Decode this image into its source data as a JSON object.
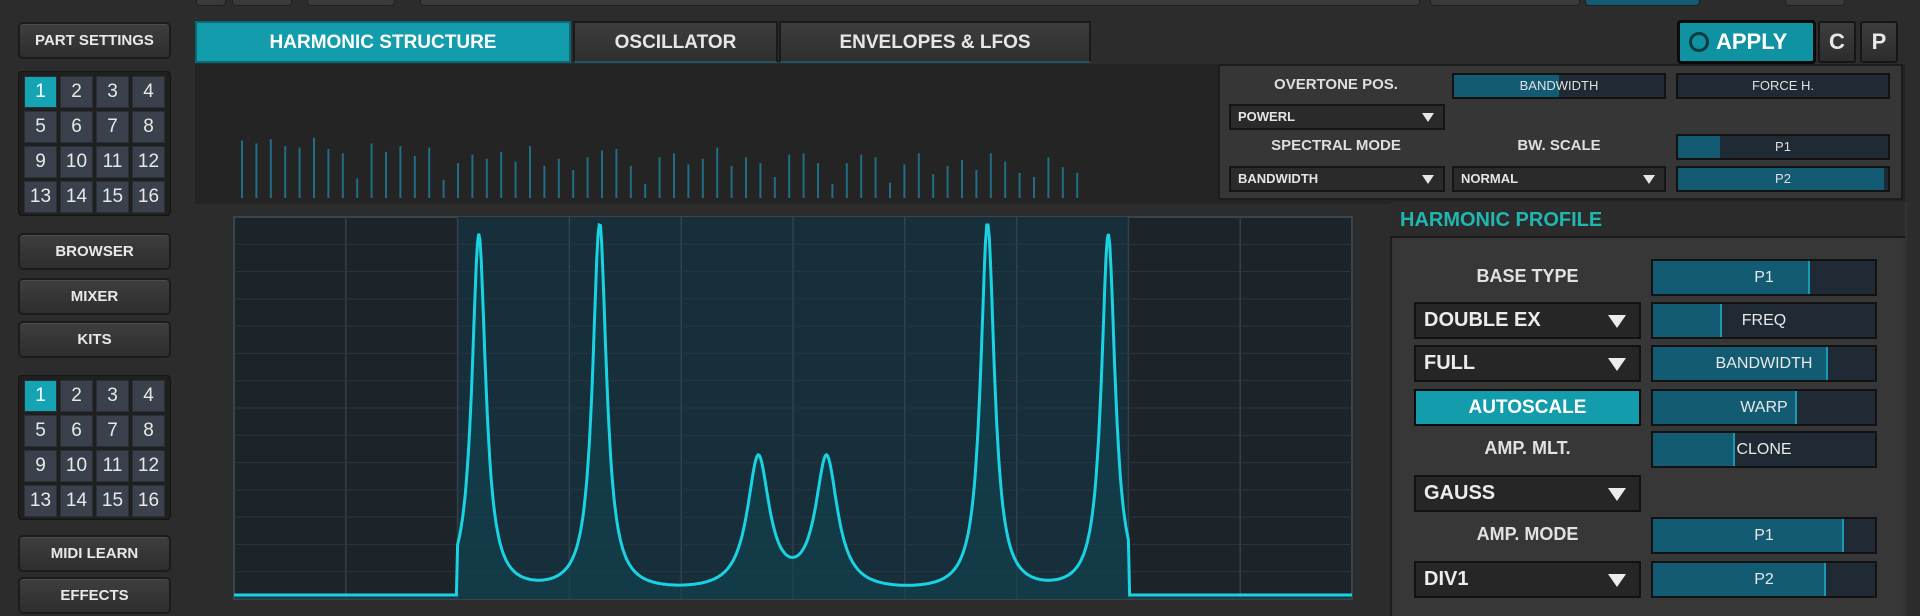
{
  "left_panel": {
    "part_settings_label": "PART SETTINGS",
    "part_grid": [
      "1",
      "2",
      "3",
      "4",
      "5",
      "6",
      "7",
      "8",
      "9",
      "10",
      "11",
      "12",
      "13",
      "14",
      "15",
      "16"
    ],
    "part_selected": "1",
    "browser_label": "BROWSER",
    "mixer_label": "MIXER",
    "kits_label": "KITS",
    "kit_grid": [
      "1",
      "2",
      "3",
      "4",
      "5",
      "6",
      "7",
      "8",
      "9",
      "10",
      "11",
      "12",
      "13",
      "14",
      "15",
      "16"
    ],
    "kit_selected": "1",
    "midi_learn_label": "MIDI LEARN",
    "effects_label": "EFFECTS"
  },
  "tabs": [
    {
      "label": "HARMONIC STRUCTURE",
      "active": true
    },
    {
      "label": "OSCILLATOR",
      "active": false
    },
    {
      "label": "ENVELOPES & LFOS",
      "active": false
    }
  ],
  "header_buttons": {
    "apply_label": "APPLY",
    "c_label": "C",
    "p_label": "P"
  },
  "overtone_panel": {
    "overtone_pos_label": "OVERTONE POS.",
    "overtone_pos_value": "POWERL",
    "bandwidth_slider": {
      "label": "BANDWIDTH",
      "level": 0.5
    },
    "force_h_slider": {
      "label": "FORCE H.",
      "level": 0.0
    },
    "spectral_mode_label": "SPECTRAL MODE",
    "spectral_mode_value": "BANDWIDTH",
    "bw_scale_label": "BW. SCALE",
    "bw_scale_value": "NORMAL",
    "p1_slider": {
      "label": "P1",
      "level": 0.2
    },
    "p2_slider": {
      "label": "P2",
      "level": 0.98
    }
  },
  "harmonic_bars": [
    0.82,
    0.78,
    0.84,
    0.74,
    0.72,
    0.86,
    0.7,
    0.64,
    0.28,
    0.78,
    0.66,
    0.74,
    0.6,
    0.72,
    0.26,
    0.5,
    0.62,
    0.56,
    0.66,
    0.52,
    0.74,
    0.46,
    0.56,
    0.4,
    0.58,
    0.68,
    0.7,
    0.46,
    0.2,
    0.58,
    0.64,
    0.48,
    0.56,
    0.72,
    0.46,
    0.58,
    0.5,
    0.3,
    0.62,
    0.64,
    0.5,
    0.2,
    0.5,
    0.62,
    0.58,
    0.22,
    0.48,
    0.64,
    0.34,
    0.46,
    0.54,
    0.4,
    0.64,
    0.52,
    0.36,
    0.3,
    0.58,
    0.44,
    0.36
  ],
  "profile_curve_peaks": [
    {
      "x": 0.219,
      "height": 0.97
    },
    {
      "x": 0.327,
      "height": 1.0
    },
    {
      "x": 0.469,
      "height": 0.36
    },
    {
      "x": 0.53,
      "height": 0.36
    },
    {
      "x": 0.674,
      "height": 1.0
    },
    {
      "x": 0.782,
      "height": 0.97
    }
  ],
  "harmonic_profile": {
    "title": "HARMONIC PROFILE",
    "base_type_label": "BASE TYPE",
    "base_type_value": "DOUBLE EX",
    "range_value": "FULL",
    "autoscale_label": "AUTOSCALE",
    "amp_mlt_label": "AMP. MLT.",
    "amp_mlt_value": "GAUSS",
    "amp_mode_label": "AMP. MODE",
    "amp_mode_value": "DIV1",
    "sliders": [
      {
        "label": "P1",
        "level": 0.7
      },
      {
        "label": "FREQ",
        "level": 0.3
      },
      {
        "label": "BANDWIDTH",
        "level": 0.78
      },
      {
        "label": "WARP",
        "level": 0.64
      },
      {
        "label": "CLONE",
        "level": 0.36
      },
      {
        "label": "P1",
        "level": 0.85
      },
      {
        "label": "P2",
        "level": 0.77
      }
    ]
  }
}
